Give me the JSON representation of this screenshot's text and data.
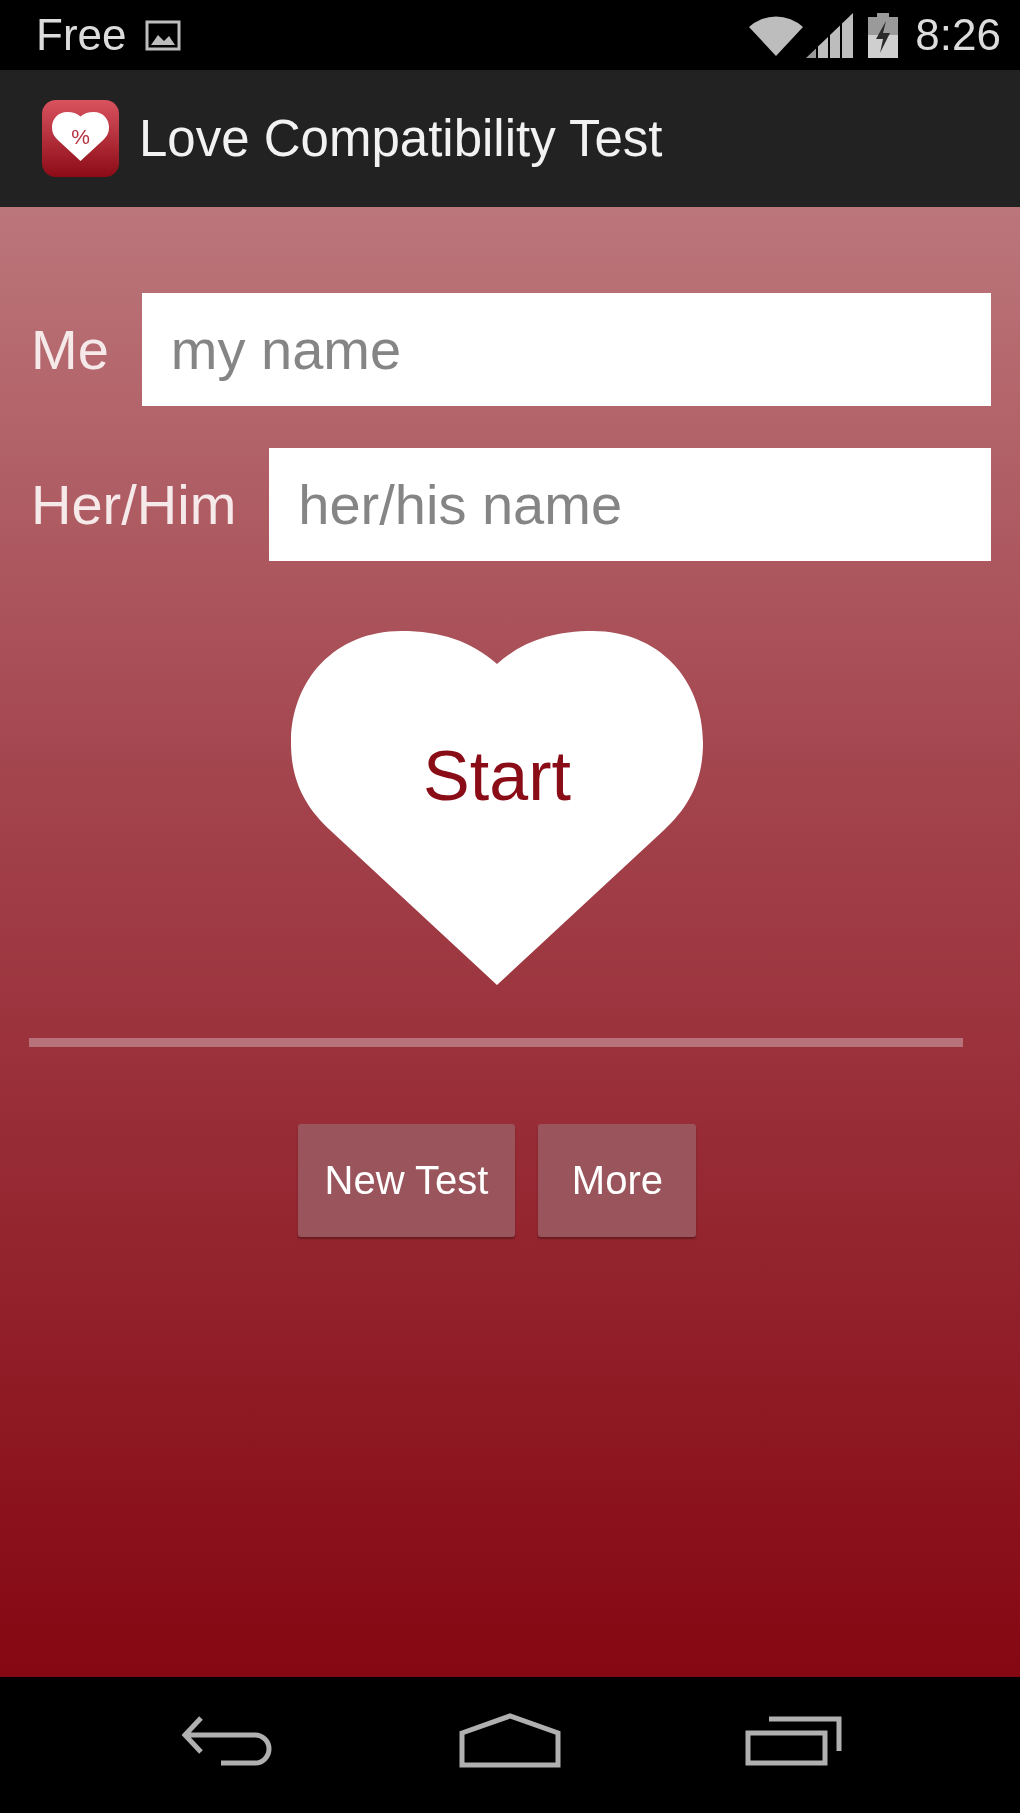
{
  "status_bar": {
    "carrier": "Free",
    "time": "8:26"
  },
  "app_bar": {
    "logo_text": "%",
    "title": "Love Compatibility Test"
  },
  "form": {
    "fields": [
      {
        "label": "Me",
        "placeholder": "my name"
      },
      {
        "label": "Her/Him",
        "placeholder": "her/his name"
      }
    ]
  },
  "start_button": {
    "label": "Start"
  },
  "buttons": [
    {
      "label": "New Test"
    },
    {
      "label": "More"
    }
  ]
}
